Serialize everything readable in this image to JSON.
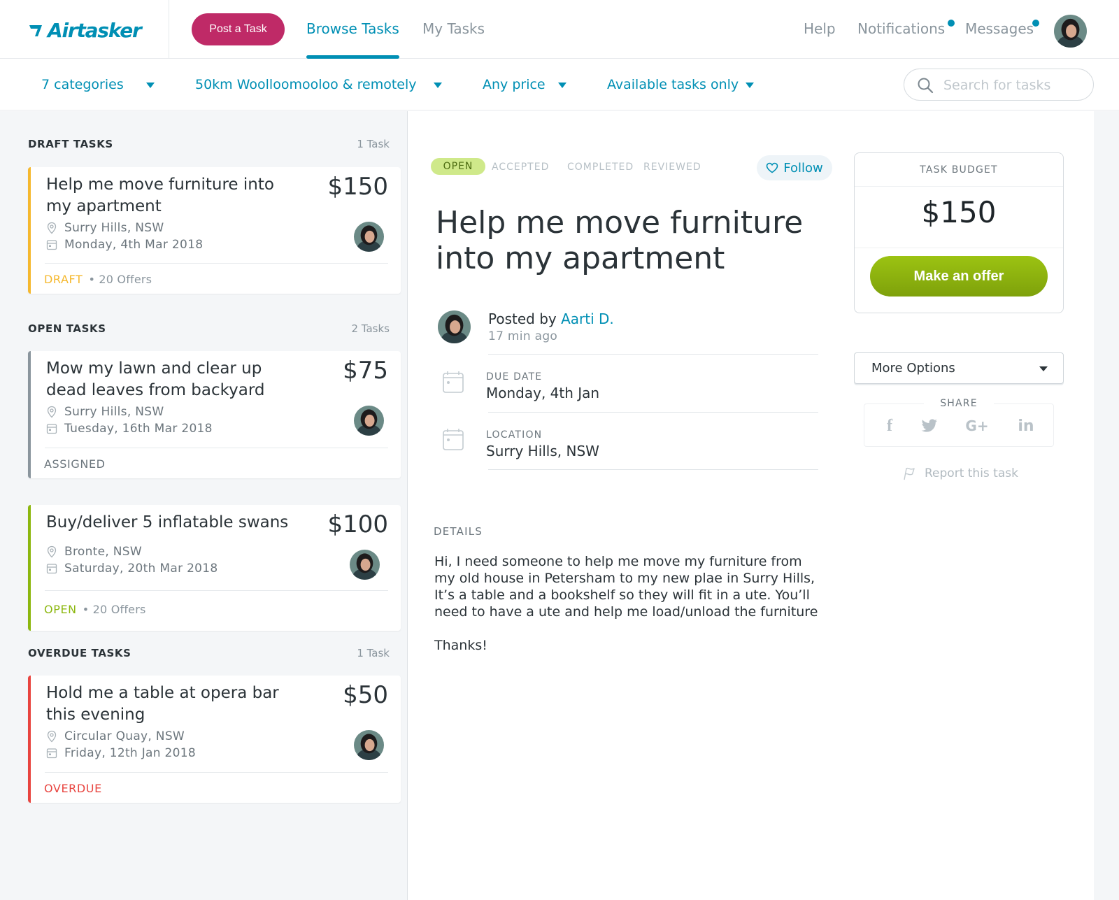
{
  "header": {
    "logo_text": "Airtasker",
    "post_task_label": "Post a Task",
    "nav": {
      "browse": "Browse Tasks",
      "my_tasks": "My Tasks",
      "help": "Help",
      "notifications": "Notifications",
      "messages": "Messages"
    }
  },
  "filters": {
    "categories": "7 categories",
    "location": "50km Woolloomooloo & remotely",
    "price": "Any price",
    "availability": "Available tasks only",
    "search_placeholder": "Search for tasks"
  },
  "sidebar": {
    "draft": {
      "title": "DRAFT TASKS",
      "count": "1 Task",
      "tasks": [
        {
          "title": "Help me move furniture into my apartment",
          "price": "$150",
          "location": "Surry Hills, NSW",
          "date": "Monday, 4th Mar 2018",
          "status": "DRAFT",
          "offers": "• 20 Offers"
        }
      ]
    },
    "open": {
      "title": "OPEN TASKS",
      "count": "2 Tasks",
      "tasks": [
        {
          "title": "Mow my lawn and clear up dead leaves from backyard",
          "price": "$75",
          "location": "Surry Hills, NSW",
          "date": "Tuesday, 16th Mar 2018",
          "status": "ASSIGNED",
          "offers": ""
        },
        {
          "title": "Buy/deliver 5 inflatable swans",
          "price": "$100",
          "location": "Bronte, NSW",
          "date": "Saturday, 20th Mar 2018",
          "status": "OPEN",
          "offers": "• 20 Offers"
        }
      ]
    },
    "overdue": {
      "title": "OVERDUE TASKS",
      "count": "1 Task",
      "tasks": [
        {
          "title": "Hold me a table at opera bar this evening",
          "price": "$50",
          "location": "Circular Quay, NSW",
          "date": "Friday, 12th Jan 2018",
          "status": "OVERDUE",
          "offers": ""
        }
      ]
    }
  },
  "task": {
    "status_steps": [
      "OPEN",
      "ACCEPTED",
      "COMPLETED",
      "REVIEWED"
    ],
    "current_step": "OPEN",
    "follow_label": "Follow",
    "title": "Help me move furniture into my apartment",
    "posted_by_prefix": "Posted by",
    "posted_by_name": "Aarti D.",
    "posted_time": "17 min ago",
    "due_date_label": "DUE DATE",
    "due_date": "Monday, 4th Jan",
    "location_label": "LOCATION",
    "location": "Surry Hills, NSW",
    "details_label": "DETAILS",
    "details": "Hi, I need someone to help me move my furniture from my old house in Petersham to my new plae in Surry Hills, It’s a table and a bookshelf so they will fit in a ute. You’ll need to have a ute and help me load/unload the furniture\n\nThanks!"
  },
  "budget": {
    "label": "TASK BUDGET",
    "amount": "$150",
    "offer_button": "Make an offer"
  },
  "more_options_label": "More Options",
  "share": {
    "label": "SHARE",
    "icons": [
      "facebook-icon",
      "twitter-icon",
      "google-plus-icon",
      "linkedin-icon"
    ],
    "google_plus_text": "G+",
    "linkedin_text": "in",
    "facebook_text": "f"
  },
  "report_label": "Report this task",
  "colors": {
    "brand": "#008fb4",
    "post_button": "#bf2a67",
    "draft": "#f5b82e",
    "assigned": "#8a959d",
    "open": "#8cb70f",
    "overdue": "#e8443f",
    "offer_button": "#8cb70f"
  }
}
